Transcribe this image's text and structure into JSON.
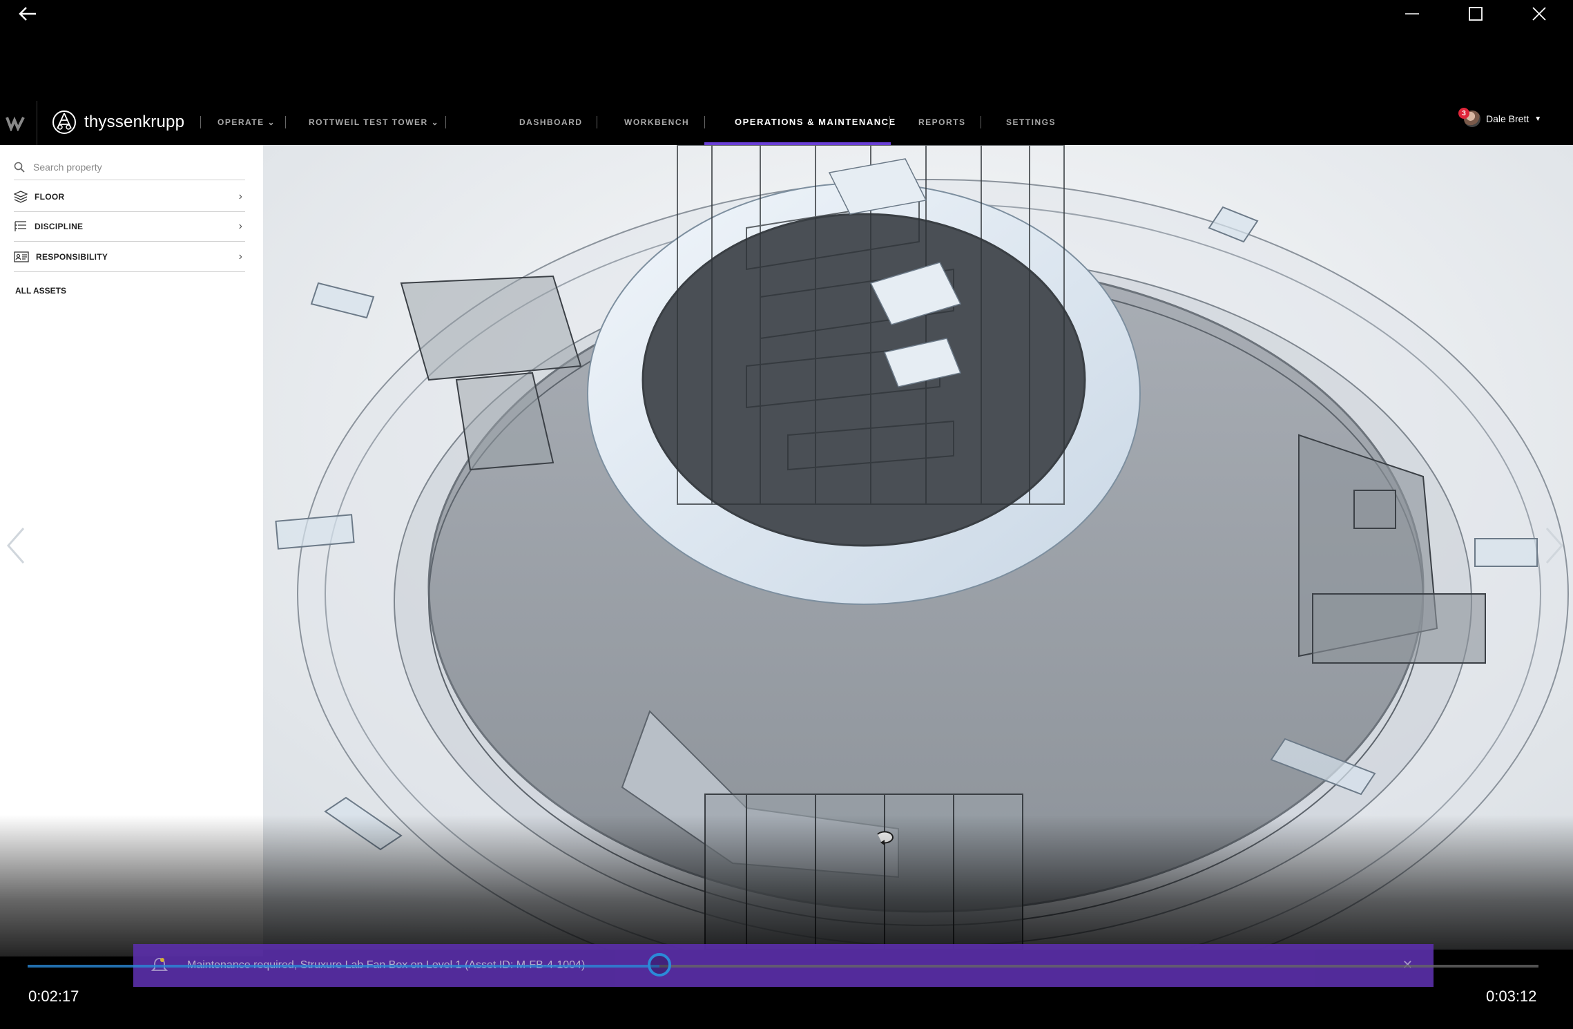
{
  "window": {
    "back": "back-arrow-icon",
    "minimize": "minimize-icon",
    "maximize": "maximize-icon",
    "close": "close-icon"
  },
  "header": {
    "brand": "thyssenkrupp",
    "nav": [
      {
        "label": "OPERATE"
      },
      {
        "label": "ROTTWEIL TEST TOWER"
      },
      {
        "label": "DASHBOARD"
      },
      {
        "label": "WORKBENCH"
      },
      {
        "label": "OPERATIONS & MAINTENANCE"
      },
      {
        "label": "REPORTS"
      },
      {
        "label": "SETTINGS"
      }
    ],
    "active_tab": "OPERATIONS & MAINTENANCE",
    "user": {
      "name": "Dale Brett",
      "notifications": "3"
    }
  },
  "sidebar": {
    "search_placeholder": "Search property",
    "filters": [
      {
        "label": "FLOOR",
        "icon": "layers-icon"
      },
      {
        "label": "DISCIPLINE",
        "icon": "list-tree-icon"
      },
      {
        "label": "RESPONSIBILITY",
        "icon": "id-card-icon"
      }
    ],
    "all_assets": "ALL ASSETS"
  },
  "notification": {
    "text": "Maintenance required, Struxure Lab Fan Box on Level 1 (Asset ID: M-FB-4-1004)"
  },
  "player": {
    "current_time": "0:02:17",
    "total_time": "0:03:12",
    "progress": 0.418
  },
  "colors": {
    "accent": "#6a3fd6",
    "notification_bg": "#5a2fa8",
    "seek": "#2b8ad8",
    "badge": "#e0263a"
  }
}
